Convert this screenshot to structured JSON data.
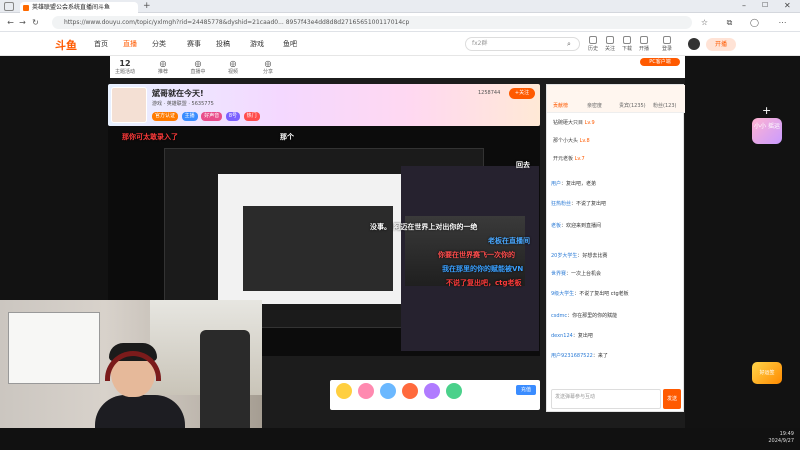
{
  "browser": {
    "tab_title": "英雄联盟公会系统直播间斗鱼",
    "url": "https://www.douyu.com/topic/yxlmgh?rid=24485778&dyshid=21caad0... 8957f43e4dd8d8d2716565100117014cp"
  },
  "header": {
    "logo": "斗鱼",
    "nav": [
      "首页",
      "直播",
      "分类",
      "赛事",
      "投稿",
      "游戏",
      "鱼吧"
    ],
    "search_placeholder": "fx2群",
    "icons": [
      "历史",
      "关注",
      "下载",
      "开播",
      "登录"
    ],
    "start_live": "开播"
  },
  "categories": [
    {
      "num": "12",
      "label": "主题活动"
    },
    {
      "num": "",
      "label": "推荐"
    },
    {
      "num": "",
      "label": "直播中"
    },
    {
      "num": "",
      "label": "视频"
    },
    {
      "num": "",
      "label": "分享"
    }
  ],
  "room": {
    "title": "斌哥就在今天!",
    "meta": "游戏 · 英雄联盟 · 5635775",
    "tags": [
      "官方认证",
      "主播",
      "好声音",
      "8号",
      "热门"
    ],
    "follow": "+关注",
    "count": "1258744"
  },
  "danmaku": [
    {
      "text": "那你可太敢录入了",
      "color": "#ff3b3b"
    },
    {
      "text": "没事。 阿迈在世界上对出你的一绝",
      "color": "#ffffff"
    },
    {
      "text": "老板在直播间",
      "color": "#4aa8ff"
    },
    {
      "text": "你要在世界赛飞一次你的",
      "color": "#ff4d4d"
    },
    {
      "text": "我在那里的你的赋能被VN",
      "color": "#3aa0ff"
    },
    {
      "text": "不说了复出吧，ctg老板",
      "color": "#ff3b3b"
    },
    {
      "text": "那个",
      "color": "#ffffff"
    },
    {
      "text": "回去",
      "color": "#ffffff"
    }
  ],
  "sidebar": {
    "tabs": [
      "贡献榜",
      "亲密度",
      "贵宾(1235)",
      "粉丝(123)"
    ],
    "fans": [
      {
        "name": "钻碗砸大只目",
        "level": "Lv.9"
      },
      {
        "name": "那个小大头",
        "level": "Lv.8"
      },
      {
        "name": "开元老板",
        "level": "Lv.7"
      }
    ],
    "messages": [
      {
        "name": "用户",
        "text": "复出吧，老弟"
      },
      {
        "name": "狂热粉丝",
        "text": "不说了复出吧"
      },
      {
        "name": "老板",
        "text": "欢迎来到直播间"
      },
      {
        "name": "20岁大学生",
        "text": "好想去比赛"
      },
      {
        "name": "世界赛",
        "text": "一次上台机会"
      },
      {
        "name": "9级大学生",
        "text": "不说了复出吧 ctg老板"
      },
      {
        "name": "csdmc",
        "text": "你在那里的你的赋能"
      },
      {
        "name": "dexn124",
        "text": "复出吧"
      },
      {
        "name": "用户9231687522",
        "text": "来了"
      }
    ],
    "input_placeholder": "发送弹幕参与互动",
    "send": "发送"
  },
  "gifts": [
    "荧光棒",
    "办卡",
    "飞机",
    "火箭",
    "超级火箭",
    "嘉年华"
  ],
  "right_badges": {
    "top": "小小 摇运",
    "bottom": "好运签"
  },
  "clock": {
    "time": "19:49",
    "date": "2024/9/27"
  }
}
